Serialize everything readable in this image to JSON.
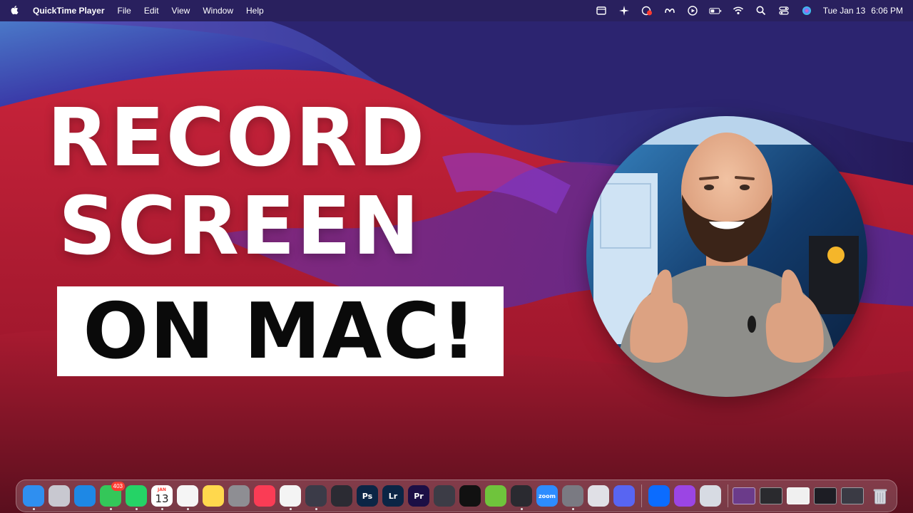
{
  "menubar": {
    "apple_icon": "apple-icon",
    "app_name": "QuickTime Player",
    "menus": [
      "File",
      "Edit",
      "View",
      "Window",
      "Help"
    ],
    "status_icons": [
      "screen-capture-icon",
      "sparkle-icon",
      "recording-icon",
      "meta-icon",
      "play-circle-icon",
      "battery-icon",
      "wifi-icon",
      "search-icon",
      "control-center-icon",
      "siri-icon"
    ],
    "date": "Tue Jan 13",
    "time": "6:06 PM"
  },
  "headline": {
    "line1": "RECORD",
    "line2": "SCREEN",
    "banner": "ON MAC!"
  },
  "dock": {
    "apps": [
      {
        "name": "finder",
        "label": "",
        "color": "#2f8ff0",
        "running": true
      },
      {
        "name": "launchpad",
        "label": "",
        "color": "#c8c8d0",
        "running": false
      },
      {
        "name": "safari",
        "label": "",
        "color": "#1e88e5",
        "running": false
      },
      {
        "name": "messages",
        "label": "",
        "color": "#34c759",
        "running": true,
        "badge": "403"
      },
      {
        "name": "whatsapp",
        "label": "",
        "color": "#25d366",
        "running": true
      },
      {
        "name": "calendar",
        "label": "",
        "color": "#ffffff",
        "running": true,
        "month": "JAN",
        "day": "13"
      },
      {
        "name": "reminders",
        "label": "",
        "color": "#f5f5f5",
        "running": true
      },
      {
        "name": "notes",
        "label": "",
        "color": "#ffd84d",
        "running": false
      },
      {
        "name": "calculator",
        "label": "",
        "color": "#8e8e93",
        "running": false
      },
      {
        "name": "music",
        "label": "",
        "color": "#fa3c55",
        "running": false
      },
      {
        "name": "chrome",
        "label": "",
        "color": "#f4f4f4",
        "running": true
      },
      {
        "name": "quicktime",
        "label": "",
        "color": "#3b3b48",
        "running": true
      },
      {
        "name": "obs",
        "label": "",
        "color": "#2b2b33",
        "running": false
      },
      {
        "name": "photoshop",
        "label": "Ps",
        "color": "#0b2545",
        "running": false
      },
      {
        "name": "lightroom",
        "label": "Lr",
        "color": "#0b2545",
        "running": false
      },
      {
        "name": "premiere",
        "label": "Pr",
        "color": "#1c0f45",
        "running": false
      },
      {
        "name": "davinci",
        "label": "",
        "color": "#3c3c46",
        "running": false
      },
      {
        "name": "perplexity",
        "label": "",
        "color": "#111111",
        "running": false
      },
      {
        "name": "app-green",
        "label": "",
        "color": "#6fc43c",
        "running": false
      },
      {
        "name": "final-cut",
        "label": "",
        "color": "#2a2a30",
        "running": true
      },
      {
        "name": "zoom",
        "label": "zoom",
        "color": "#2d8cff",
        "running": false
      },
      {
        "name": "system-settings",
        "label": "",
        "color": "#7a7a82",
        "running": true
      },
      {
        "name": "iphone-mirroring",
        "label": "",
        "color": "#e0e0e6",
        "running": false
      },
      {
        "name": "discord",
        "label": "",
        "color": "#5865f2",
        "running": false
      }
    ],
    "apps2": [
      {
        "name": "meta",
        "label": "",
        "color": "#0b6cff",
        "running": false
      },
      {
        "name": "podcasts",
        "label": "",
        "color": "#9b45e4",
        "running": false
      },
      {
        "name": "preview",
        "label": "",
        "color": "#d7dbe3",
        "running": false
      }
    ],
    "windows": [
      {
        "name": "window-macbook",
        "color": "#6b3b8a"
      },
      {
        "name": "window-editor",
        "color": "#2a2a2e"
      },
      {
        "name": "window-browser",
        "color": "#f0f0f0"
      },
      {
        "name": "window-photoshop",
        "color": "#1d1d24"
      },
      {
        "name": "window-finder",
        "color": "#3a3a44"
      }
    ],
    "trash": {
      "name": "trash",
      "color": "#c9ccd4"
    }
  }
}
